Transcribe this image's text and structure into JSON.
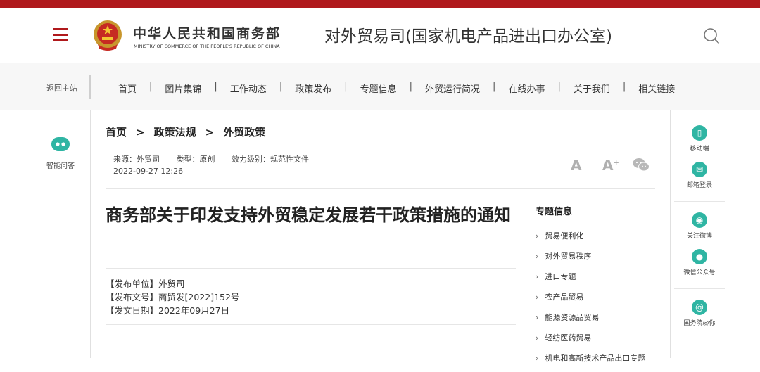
{
  "header": {
    "brand_cn": "中华人民共和国商务部",
    "brand_en": "MINISTRY OF COMMERCE OF THE PEOPLE'S REPUBLIC OF CHINA",
    "department": "对外贸易司(国家机电产品进出口办公室)",
    "accent_color": "#b0191c"
  },
  "nav": {
    "home": "返回主站",
    "items": [
      "首页",
      "图片集锦",
      "工作动态",
      "政策发布",
      "专题信息",
      "外贸运行简况",
      "在线办事",
      "关于我们",
      "相关链接"
    ],
    "separator": "|"
  },
  "left_sidebar": {
    "assistant_label": "智能问答"
  },
  "right_sidebar": {
    "items": [
      {
        "label": "移动端",
        "icon": "mobile-icon"
      },
      {
        "label": "邮箱登录",
        "icon": "mail-icon"
      },
      {
        "label": "关注微博",
        "icon": "weibo-icon"
      },
      {
        "label": "微信公众号",
        "icon": "wechat-icon"
      },
      {
        "label": "国务院@你",
        "icon": "at-icon"
      }
    ]
  },
  "breadcrumb": {
    "items": [
      "首页",
      "政策法规",
      "外贸政策"
    ],
    "sep": ">"
  },
  "meta": {
    "source": "来源：外贸司",
    "type": "类型：原创",
    "level": "效力级别：规范性文件",
    "datetime": "2022-09-27 12:26"
  },
  "tools": {
    "font_large": "A",
    "font_plus": "A",
    "plus_mark": "+"
  },
  "article": {
    "title": "商务部关于印发支持外贸稳定发展若干政策措施的通知",
    "publisher": "【发布单位】外贸司",
    "doc_no": "【发布文号】商贸发[2022]152号",
    "date": "【发文日期】2022年09月27日"
  },
  "topics": {
    "heading": "专题信息",
    "items": [
      "贸易便利化",
      "对外贸易秩序",
      "进口专题",
      "农产品贸易",
      "能源资源品贸易",
      "轻纺医药贸易",
      "机电和高新技术产品出口专题"
    ]
  }
}
